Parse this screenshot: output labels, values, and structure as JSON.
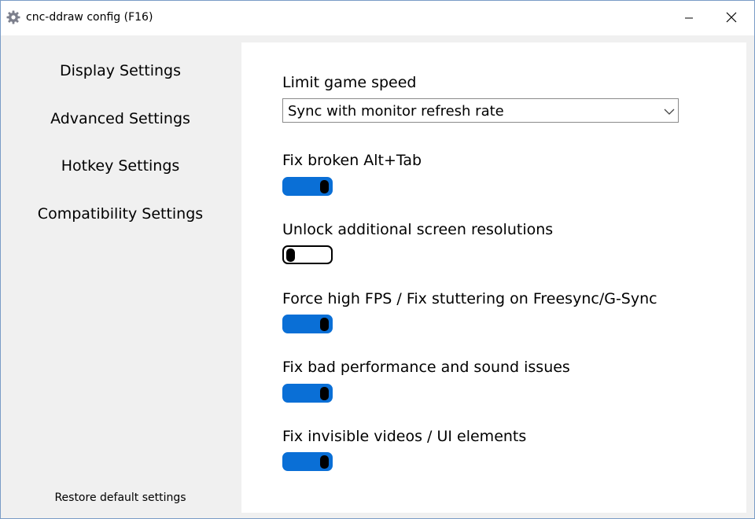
{
  "window": {
    "title": "cnc-ddraw config (F16)"
  },
  "sidebar": {
    "items": [
      {
        "label": "Display Settings"
      },
      {
        "label": "Advanced Settings"
      },
      {
        "label": "Hotkey Settings"
      },
      {
        "label": "Compatibility Settings"
      }
    ],
    "restore_label": "Restore default settings"
  },
  "settings": {
    "limit_speed": {
      "label": "Limit game speed",
      "value": "Sync with monitor refresh rate"
    },
    "toggles": [
      {
        "label": "Fix broken Alt+Tab",
        "on": true
      },
      {
        "label": "Unlock additional screen resolutions",
        "on": false
      },
      {
        "label": "Force high FPS / Fix stuttering on Freesync/G-Sync",
        "on": true
      },
      {
        "label": "Fix bad performance and sound issues",
        "on": true
      },
      {
        "label": "Fix invisible videos / UI elements",
        "on": true
      }
    ]
  },
  "colors": {
    "accent": "#0a6fd6",
    "panel_bg": "#ffffff",
    "window_bg": "#f0f0f0"
  },
  "icons": {
    "app": "gear-icon",
    "minimize": "minimize-icon",
    "close": "close-icon",
    "dropdown": "chevron-down-icon"
  }
}
